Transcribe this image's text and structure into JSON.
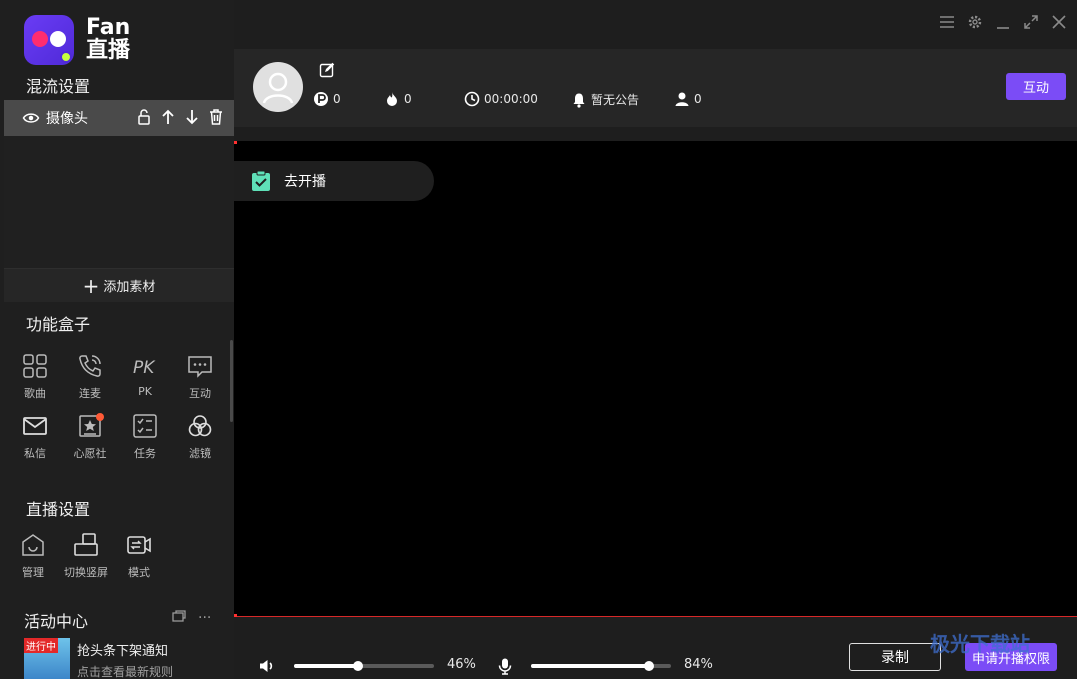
{
  "app": {
    "brand_line1": "Fan",
    "brand_line2": "直播"
  },
  "sidebar": {
    "mix_title": "混流设置",
    "source_name": "摄像头",
    "add_material": "添加素材",
    "func_title": "功能盒子",
    "func_items": [
      "歌曲",
      "连麦",
      "PK",
      "互动",
      "私信",
      "心愿社",
      "任务",
      "滤镜"
    ],
    "pk_glyph": "PK",
    "live_title": "直播设置",
    "live_items": [
      "管理",
      "切换竖屏",
      "模式"
    ],
    "activity_title": "活动中心",
    "activity_tools": "···",
    "activity_tag": "进行中",
    "activity_name": "抢头条下架通知",
    "activity_sub": "点击查看最新规则"
  },
  "header": {
    "coins": "0",
    "heat": "0",
    "duration": "00:00:00",
    "notice": "暂无公告",
    "viewers": "0",
    "interact_label": "互动"
  },
  "stage": {
    "golive_label": "去开播"
  },
  "bottom": {
    "speaker_pct": "46%",
    "speaker_value": 46,
    "mic_pct": "84%",
    "mic_value": 84,
    "record_label": "录制",
    "apply_label": "申请开播权限"
  },
  "watermark": "极光下载站",
  "colors": {
    "accent": "#7b4cf6",
    "brand_red": "#ff2d6f",
    "badge": "#c7ff3d",
    "alert": "#d72828"
  }
}
